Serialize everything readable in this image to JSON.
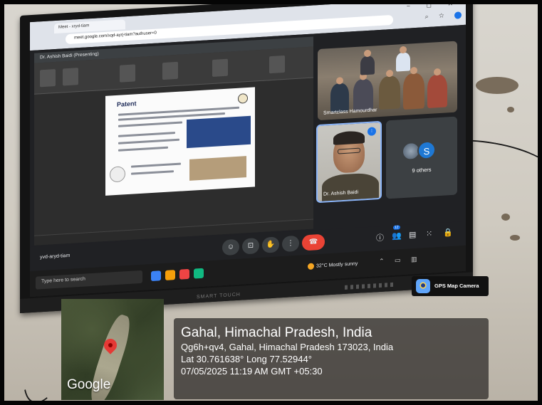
{
  "browser": {
    "tab_title": "Meet - xryd-tiam",
    "url": "meet.google.com/xqd-ayrj-tiam?authuser=0",
    "window_controls": "− ◻ ✕",
    "toolbar_icons": "⌕ ☆"
  },
  "presentation": {
    "presenter_banner": "Dr. Ashish Baidi (Presenting)",
    "slide_title": "Patent"
  },
  "participants": {
    "room_label": "Smartclass Hamourdhar",
    "speaker_label": "Dr. Ashish Baidi",
    "others_label": "9 others",
    "others_initial": "S",
    "participant_badge": "12"
  },
  "meet_bar": {
    "meeting_code": "yvd-aryd-tiam"
  },
  "taskbar": {
    "search_placeholder": "Type here to search",
    "weather": "32°C  Mostly sunny"
  },
  "watermark": {
    "app_name": "GPS Map Camera",
    "map_brand": "Google",
    "place": "Gahal, Himachal Pradesh, India",
    "address": "Qg6h+qv4, Gahal, Himachal Pradesh 173023, India",
    "coords": "Lat 30.761638° Long 77.52944°",
    "datetime": "07/05/2025 11:19 AM GMT +05:30"
  },
  "tv": {
    "brand": "SMART TOUCH"
  },
  "colors": {
    "meet_end_call": "#ea4335",
    "meet_accent": "#1a73e8",
    "meet_background": "#202124"
  }
}
